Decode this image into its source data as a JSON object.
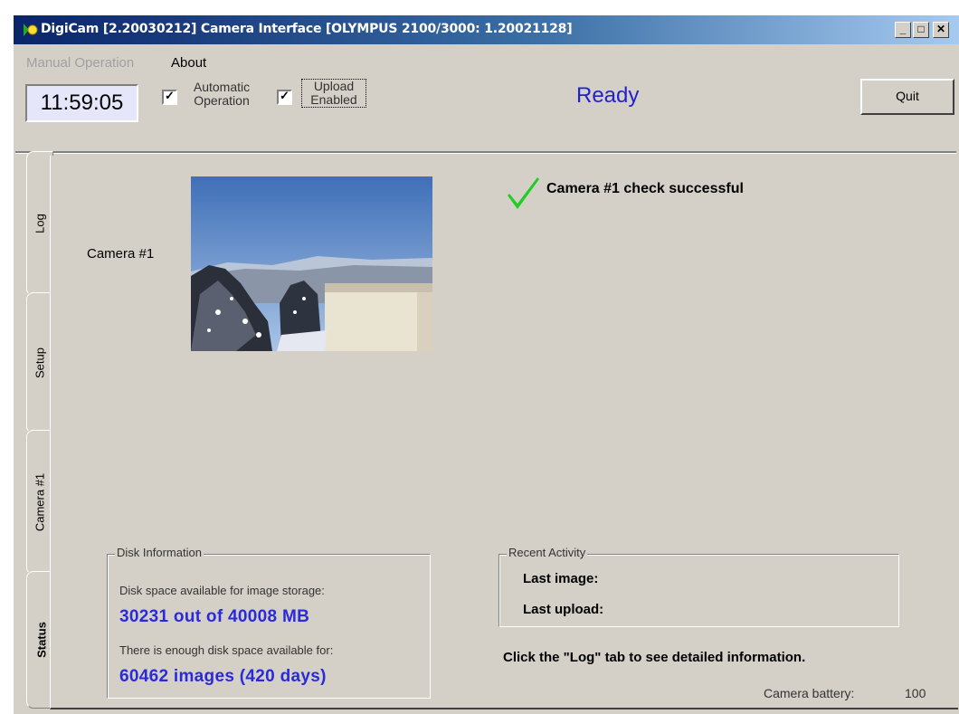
{
  "window": {
    "title": "DigiCam [2.20030212]  Camera Interface [OLYMPUS 2100/3000: 1.20021128]",
    "controls": {
      "minimize": "_",
      "maximize": "□",
      "close": "✕"
    }
  },
  "menu": {
    "items": [
      {
        "label": "Manual Operation",
        "enabled": false
      },
      {
        "label": "About",
        "enabled": true
      }
    ]
  },
  "toolbar": {
    "clock": "11:59:05",
    "auto_operation": {
      "line1": "Automatic",
      "line2": "Operation",
      "checked": true
    },
    "upload_enabled": {
      "line1": "Upload",
      "line2": "Enabled",
      "checked": true
    },
    "status": "Ready",
    "quit_label": "Quit"
  },
  "tabs": [
    {
      "label": "Log",
      "active": false
    },
    {
      "label": "Setup",
      "active": false
    },
    {
      "label": "Camera #1",
      "active": false
    },
    {
      "label": "Status",
      "active": true
    }
  ],
  "status_panel": {
    "camera_label": "Camera #1",
    "check_message": "Camera #1 check successful",
    "disk": {
      "title": "Disk Information",
      "available_label": "Disk space available for image storage:",
      "available_value": "30231 out of 40008 MB",
      "enough_label": "There is enough disk space available for:",
      "enough_value": "60462 images (420 days)"
    },
    "activity": {
      "title": "Recent Activity",
      "last_image_label": "Last image:",
      "last_upload_label": "Last upload:"
    },
    "hint": "Click the \"Log\" tab to see detailed information.",
    "battery_label": "Camera battery:",
    "battery_value": "100"
  },
  "colors": {
    "status_blue": "#2222cc",
    "value_blue": "#2a2ad8",
    "check_green": "#22cc22",
    "face": "#d4d0c8"
  },
  "icons": [
    "app-icon",
    "check-icon"
  ]
}
